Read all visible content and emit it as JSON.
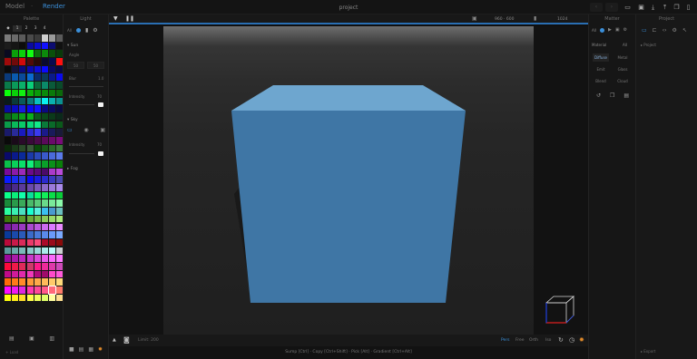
{
  "app": {
    "mode_model": "Model",
    "mode_separator": "·",
    "mode_render": "Render",
    "project_title": "project"
  },
  "palette": {
    "title": "Palette",
    "tabs": [
      "◆",
      "1",
      "2",
      "3",
      "4"
    ],
    "footer_icons": [
      "folder-icon",
      "save-icon",
      "file-icon"
    ],
    "footer_glyphs": [
      "▤",
      "▣",
      "▥"
    ],
    "link_text": "+ Load",
    "colors": [
      "#7a7a7a",
      "#6a6a6a",
      "#5a5a5a",
      "#4a4a4a",
      "#3a3a3a",
      "#cfcfcf",
      "#9a9a9a",
      "#5a5a5a",
      "#1c1c1c",
      "#151515",
      "#0c0c0c",
      "#0a0aa0",
      "#0a0ad0",
      "#1212ff",
      "#0c0c70",
      "#101010",
      "#0a0a20",
      "#0aa00a",
      "#0ad00a",
      "#12ff12",
      "#0a700a",
      "#0c8a0c",
      "#0a500a",
      "#0a3a0a",
      "#a00a0a",
      "#700a0a",
      "#d00a0a",
      "#500a0a",
      "#2a0a0a",
      "#0a0a30",
      "#0a0a50",
      "#ff1010",
      "#0a0a0a",
      "#14143a",
      "#0a0a7a",
      "#0a0ab0",
      "#0c0cd8",
      "#0a0aff",
      "#0a0a60",
      "#0a0a40",
      "#0a3a7a",
      "#0a5ab0",
      "#0a4a9a",
      "#0a6ad0",
      "#0a2a6a",
      "#0a3a5a",
      "#0a1a8a",
      "#0a0aef",
      "#0a7a4a",
      "#0a9a5a",
      "#0ab06a",
      "#0ad07a",
      "#0a6a3a",
      "#0a8a6a",
      "#0a5a3a",
      "#0a4a2a",
      "#0aff0a",
      "#0ad00a",
      "#12ef12",
      "#0ab00a",
      "#0a9a0a",
      "#0a8a0a",
      "#0a7a0a",
      "#0a6a0a",
      "#0a1a1a",
      "#0a3a3a",
      "#0a5a5a",
      "#0a7a7a",
      "#0ac0c0",
      "#0af0f0",
      "#0ab0b0",
      "#0a9090",
      "#0a0aa0",
      "#0a0ac0",
      "#1a1ae0",
      "#0a0af0",
      "#1212ff",
      "#0a0a80",
      "#0a0a60",
      "#0a0a40",
      "#0a6a1a",
      "#0a8a1a",
      "#0aa01a",
      "#0ab01a",
      "#0a5a1a",
      "#0a4a1a",
      "#0a3a1a",
      "#0a2a1a",
      "#0a9a4a",
      "#0aba5a",
      "#0aca6a",
      "#0ada7a",
      "#12ea8a",
      "#0a7a3a",
      "#0a6a2a",
      "#0a5a1a",
      "#1a1a6a",
      "#2a2a9a",
      "#1a1ac0",
      "#2a2ad0",
      "#3a3aef",
      "#1a1a8a",
      "#1a1a5a",
      "#1a1a3a",
      "#0a0a0a",
      "#1a0a1a",
      "#2a0a2a",
      "#3a0a3a",
      "#4a0a4a",
      "#5a0a5a",
      "#6a0a6a",
      "#7a0a7a",
      "#0a2a0a",
      "#1a3a1a",
      "#2a4a2a",
      "#3a5a3a",
      "#0a4a0a",
      "#1a5a1a",
      "#2a6a2a",
      "#3a7a3a",
      "#0a0a6a",
      "#0a1a8a",
      "#0a2a9a",
      "#1a3aaa",
      "#2a4aba",
      "#3a5aca",
      "#4a6ada",
      "#5a7aea",
      "#0ac04a",
      "#0ad05a",
      "#0ae06a",
      "#12f07a",
      "#0ab03a",
      "#0aa02a",
      "#0a901a",
      "#0a800a",
      "#7a0a9a",
      "#8a1aaa",
      "#9a2aba",
      "#6a0a8a",
      "#5a0a7a",
      "#4a0a6a",
      "#aa3aca",
      "#ba4ada",
      "#0a1aff",
      "#1a2aef",
      "#2a3adf",
      "#0a0aef",
      "#1a1adf",
      "#2a2acf",
      "#3a3abf",
      "#4a4aaf",
      "#3a1a7a",
      "#4a2a8a",
      "#5a3a9a",
      "#6a4aaa",
      "#7a5aba",
      "#8a6aca",
      "#9a7ada",
      "#aa8aea",
      "#0aff8a",
      "#0aef7a",
      "#12ffaa",
      "#0adf9a",
      "#0aff6a",
      "#12ef5a",
      "#0adf4a",
      "#0acf3a",
      "#1a8a3a",
      "#2a9a4a",
      "#3aaa5a",
      "#4aba6a",
      "#5aca7a",
      "#6ada8a",
      "#7aea9a",
      "#8afaaa",
      "#2affa0",
      "#3aefb0",
      "#4adfc0",
      "#1affd0",
      "#5af0e0",
      "#3ac0f0",
      "#4a9ad0",
      "#6ac0c0",
      "#3a7a0a",
      "#4a8a1a",
      "#5a9a2a",
      "#6aaa3a",
      "#7aba4a",
      "#8aca5a",
      "#9ada6a",
      "#aaea7a",
      "#7a1aa0",
      "#8a2ab0",
      "#9a3ac0",
      "#aa4ad0",
      "#ba5ae0",
      "#ca6af0",
      "#da7aff",
      "#ea8aff",
      "#0a3a9a",
      "#1a4aaa",
      "#2a5aba",
      "#3a6aca",
      "#4a7ada",
      "#5a8aea",
      "#6a9afa",
      "#7aaaff",
      "#ba0a3a",
      "#ca1a4a",
      "#da2a5a",
      "#ea3a6a",
      "#fa4a7a",
      "#aa0a2a",
      "#9a0a1a",
      "#8a0a0a",
      "#5a9a9a",
      "#6aaaaa",
      "#7ababa",
      "#8acaca",
      "#9adada",
      "#aaeaea",
      "#bafafa",
      "#cad0d0",
      "#9a0a9a",
      "#aa1aaa",
      "#ba2aba",
      "#ca3aca",
      "#da4ada",
      "#ea5aea",
      "#fa6afa",
      "#ff7aff",
      "#ff0a3a",
      "#ef1a4a",
      "#df2a5a",
      "#cf3a6a",
      "#ff1a8a",
      "#ef2a9a",
      "#df3aaa",
      "#cf4aba",
      "#c00a8a",
      "#d01a9a",
      "#e02aaa",
      "#f03aba",
      "#b00a7a",
      "#a00a6a",
      "#ff4aca",
      "#ff5ada",
      "#ff6a0a",
      "#ff7a1a",
      "#ff8a2a",
      "#ff9a3a",
      "#ffaa4a",
      "#ffba5a",
      "#ffca6a",
      "#ffda7a",
      "#ff0aff",
      "#ef1aef",
      "#df2adf",
      "#ff3ab0",
      "#ff4a9a",
      "#ff5a8a",
      "#ff6a7a",
      "#ff7a6a",
      "#ffff0a",
      "#ffef1a",
      "#ffdf2a",
      "#ffff4a",
      "#efff5a",
      "#dfff6a",
      "#ffffa0",
      "#ffe090"
    ]
  },
  "light": {
    "title": "Light",
    "tab_labels": [
      "All"
    ],
    "sections": [
      {
        "label": "Sun",
        "fields": {
          "angle_label": "Angle",
          "angle_values": [
            "50",
            "50"
          ],
          "blur_label": "Blur",
          "blur_value": "1.0",
          "intensity_label": "Intensity",
          "intensity_value": "70"
        }
      },
      {
        "label": "Sky",
        "fields": {
          "intensity_label": "Intensity",
          "intensity_value": "70"
        }
      },
      {
        "label": "Fog",
        "fields": {}
      }
    ]
  },
  "viewport": {
    "top_left_icons": [
      "triangle-down-icon",
      "pause-icon"
    ],
    "resolution": "960 · 600",
    "samples": "1024",
    "bottom_left": "Limit: 200",
    "camera_modes": [
      "Pers",
      "Free",
      "Orth",
      "Iso"
    ],
    "active_camera_mode": "Pers",
    "status_text": "Sump [Ctrl]  ·  Copy [Ctrl+Shift]  ·  Pick [Alt]  ·  Gradient [Ctrl+Alt]",
    "cube_colors": {
      "front": "#3f76a5",
      "top": "#6ea6cf",
      "right": "#3c6f9c"
    }
  },
  "material": {
    "title": "Matter",
    "header_label": "Material",
    "header_value": "All",
    "types": [
      "Diffuse",
      "Metal",
      "Emit",
      "Glass",
      "Blend",
      "Cloud"
    ],
    "active_type": "Diffuse"
  },
  "project": {
    "title": "Project",
    "section_label": "Project",
    "footer_label": "Export"
  }
}
